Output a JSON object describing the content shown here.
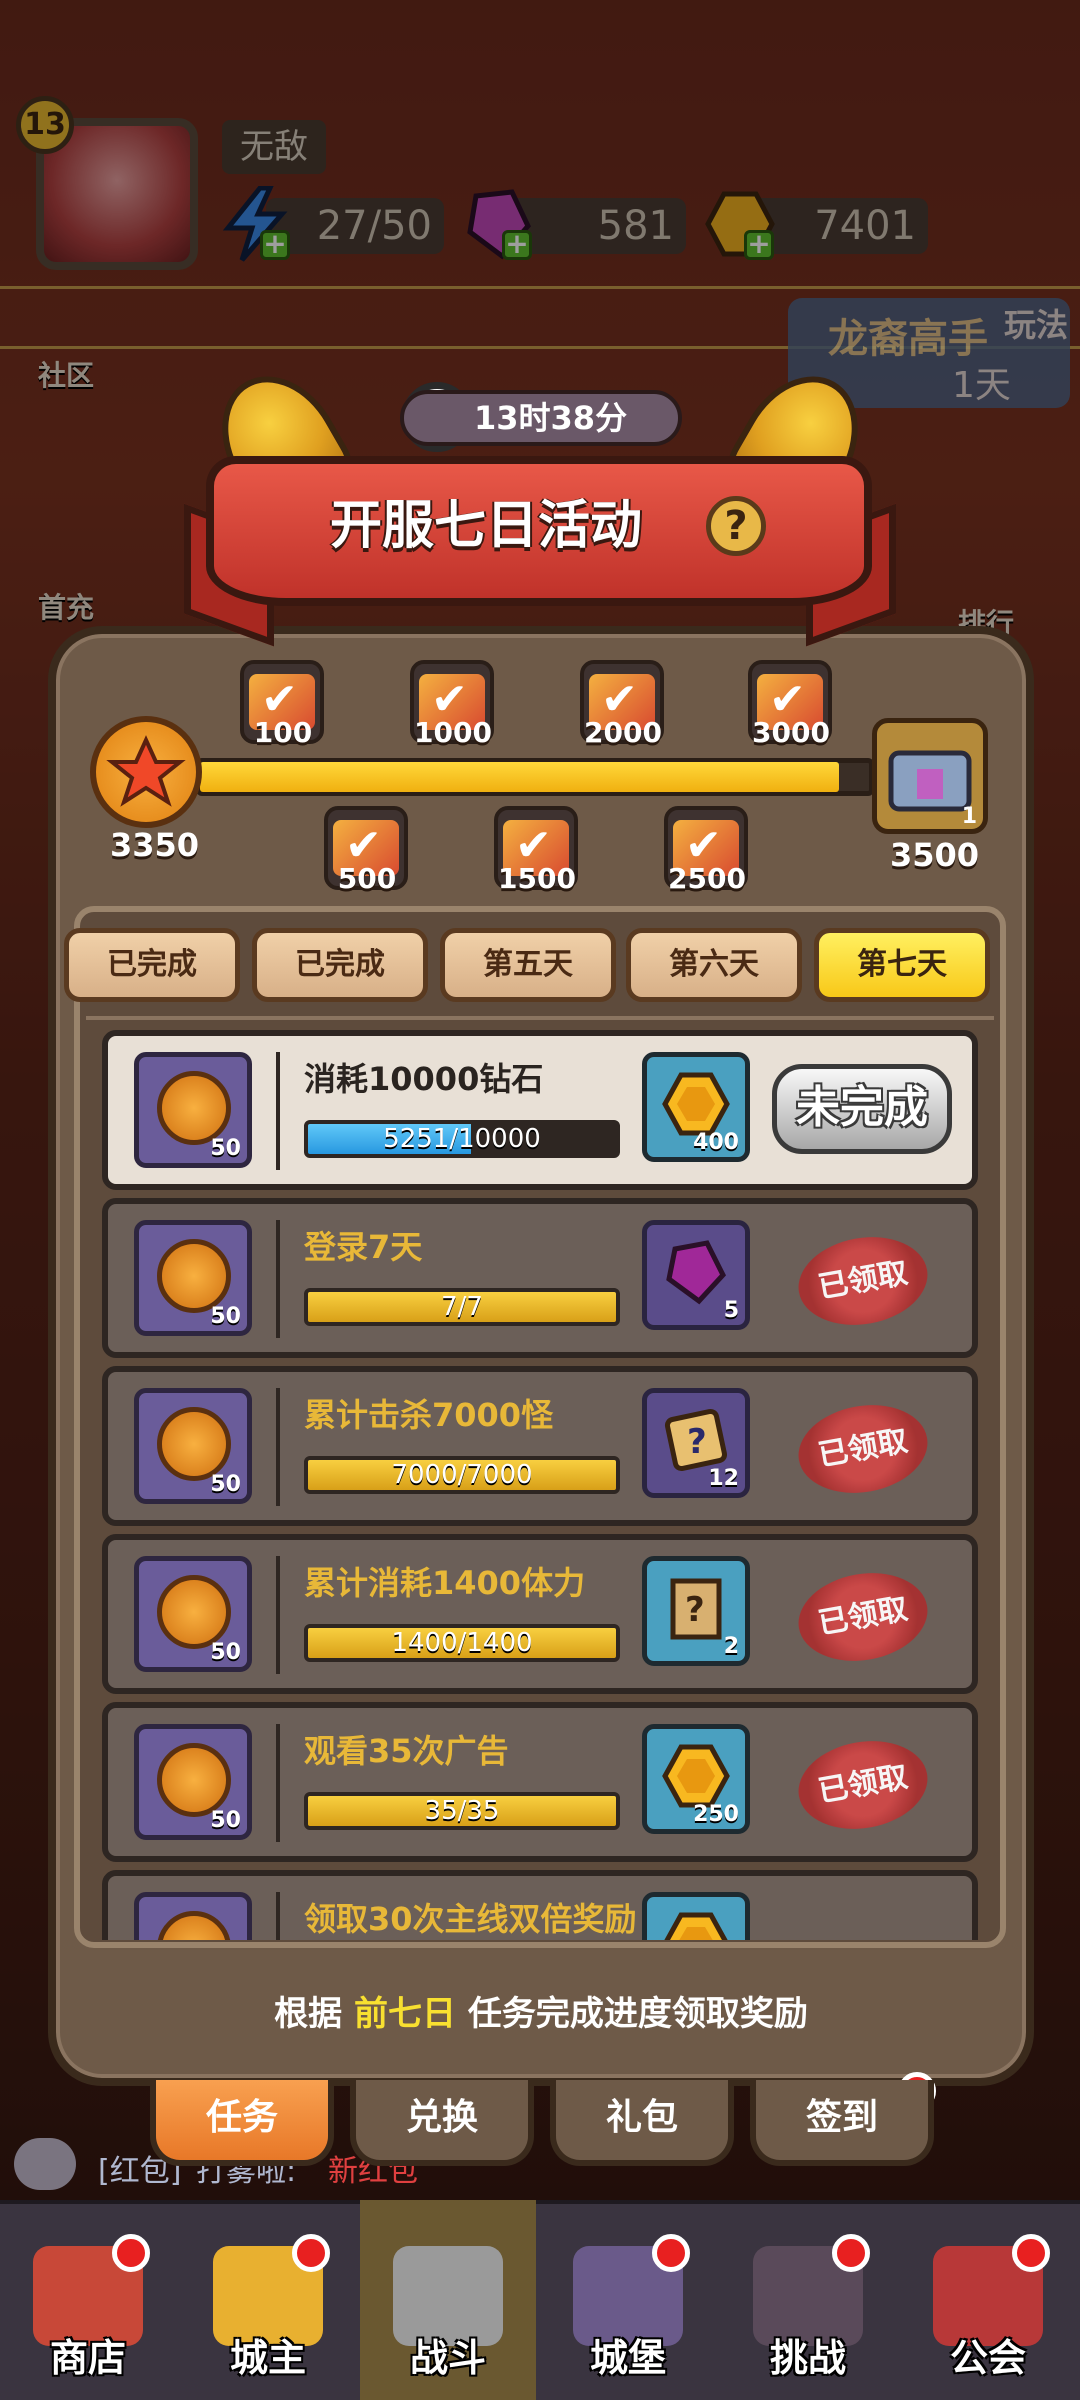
{
  "hud": {
    "level": "13",
    "name": "无敌",
    "energy": "27/50",
    "gems": "581",
    "coins": "7401",
    "side_labels": {
      "community": "社区",
      "first_charge": "首充",
      "rank": "排行"
    },
    "promo": {
      "title": "龙裔高手",
      "play": "玩法",
      "days": "1天"
    }
  },
  "event": {
    "timer": "13时38分",
    "title": "开服七日活动",
    "help_icon": "question-icon"
  },
  "progress": {
    "current_points": "3350",
    "max_points": "3500",
    "fraction": 0.957,
    "chest_count": "1",
    "milestones_top": [
      "100",
      "1000",
      "2000",
      "3000"
    ],
    "milestones_bottom": [
      "500",
      "1500",
      "2500"
    ]
  },
  "tabs": [
    {
      "label": "已完成",
      "active": false
    },
    {
      "label": "已完成",
      "active": false
    },
    {
      "label": "第五天",
      "active": false
    },
    {
      "label": "第六天",
      "active": false
    },
    {
      "label": "第七天",
      "active": true
    }
  ],
  "tasks": [
    {
      "points": "50",
      "title": "消耗10000钻石",
      "progress": "5251/10000",
      "ratio": 0.5251,
      "reward_icon": "coin-icon",
      "reward_count": "400",
      "status": "未完成",
      "active": true
    },
    {
      "points": "50",
      "title": "登录7天",
      "progress": "7/7",
      "ratio": 1,
      "reward_icon": "gem-icon",
      "reward_count": "5",
      "status": "已领取",
      "active": false
    },
    {
      "points": "50",
      "title": "累计击杀7000怪",
      "progress": "7000/7000",
      "ratio": 1,
      "reward_icon": "mystery-puzzle-icon",
      "reward_count": "12",
      "status": "已领取",
      "active": false
    },
    {
      "points": "50",
      "title": "累计消耗1400体力",
      "progress": "1400/1400",
      "ratio": 1,
      "reward_icon": "mystery-scroll-icon",
      "reward_count": "2",
      "status": "已领取",
      "active": false
    },
    {
      "points": "50",
      "title": "观看35次广告",
      "progress": "35/35",
      "ratio": 1,
      "reward_icon": "coin-icon",
      "reward_count": "250",
      "status": "已领取",
      "active": false
    },
    {
      "points": "",
      "title": "领取30次主线双倍奖励",
      "progress": "",
      "ratio": 1,
      "reward_icon": "coin-icon",
      "reward_count": "",
      "status": "",
      "active": false
    }
  ],
  "hint": {
    "before": "根据",
    "highlight": "前七日",
    "after": "任务完成进度领取奖励"
  },
  "panel_tabs": [
    "任务",
    "兑换",
    "礼包",
    "签到"
  ],
  "chat": {
    "tag": "[红包]",
    "text": "打雾啦:",
    "highlight": "新红包"
  },
  "nav": [
    "商店",
    "城主",
    "战斗",
    "城堡",
    "挑战",
    "公会"
  ]
}
